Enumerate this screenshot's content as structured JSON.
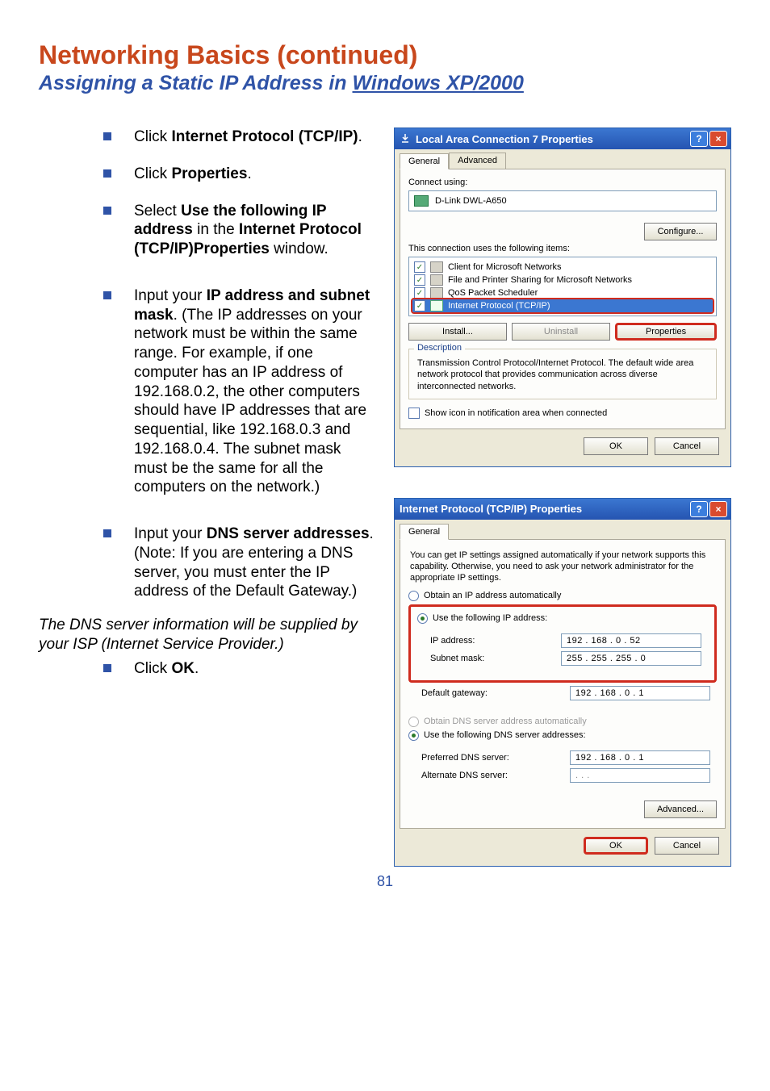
{
  "page": {
    "heading": "Networking Basics  (continued)",
    "subheading_prefix": "Assigning a Static IP Address in ",
    "subheading_underlined": "Windows XP/2000",
    "number": "81"
  },
  "bullets": {
    "b1_pre": "Click ",
    "b1_bold": "Internet Protocol (TCP/IP)",
    "b1_post": ".",
    "b2_pre": "Click ",
    "b2_bold": "Properties",
    "b2_post": ".",
    "b3_pre": "Select ",
    "b3_bold": "Use the following IP address",
    "b3_mid": " in the ",
    "b3_bold2": "Internet Protocol (TCP/IP)Properties",
    "b3_post": " window.",
    "b4_pre": "Input your ",
    "b4_bold": "IP address and subnet mask",
    "b4_post": ". (The IP addresses on your network must be within the same range. For example, if one computer has an IP address of 192.168.0.2, the other computers should have IP addresses that are sequential, like 192.168.0.3 and 192.168.0.4. The subnet mask must be the same for all the computers on the network.)",
    "b5_pre": "Input your ",
    "b5_bold": "DNS server addresses",
    "b5_post": ". (Note: If you are entering a DNS server, you must enter the IP address of the Default Gateway.)",
    "b6_pre": "Click ",
    "b6_bold": "OK",
    "b6_post": "."
  },
  "dns_note": "The DNS server information will be supplied by your ISP (Internet Service Provider.)",
  "dialog1": {
    "title": "Local Area Connection 7 Properties",
    "tab_general": "General",
    "tab_advanced": "Advanced",
    "connect_using": "Connect using:",
    "adapter": "D-Link DWL-A650",
    "configure_btn": "Configure...",
    "uses_items": "This connection uses the following items:",
    "item1": "Client for Microsoft Networks",
    "item2": "File and Printer Sharing for Microsoft Networks",
    "item3": "QoS Packet Scheduler",
    "item4": "Internet Protocol (TCP/IP)",
    "install": "Install...",
    "uninstall": "Uninstall",
    "properties": "Properties",
    "description_label": "Description",
    "description_text": "Transmission Control Protocol/Internet Protocol. The default wide area network protocol that provides communication across diverse interconnected networks.",
    "show_icon": "Show icon in notification area when connected",
    "ok": "OK",
    "cancel": "Cancel"
  },
  "dialog2": {
    "title": "Internet Protocol (TCP/IP) Properties",
    "tab_general": "General",
    "intro": "You can get IP settings assigned automatically if your network supports this capability. Otherwise, you need to ask your network administrator for the appropriate IP settings.",
    "radio_auto_ip": "Obtain an IP address automatically",
    "radio_use_ip": "Use the following IP address:",
    "ip_label": "IP address:",
    "ip_value": "192 . 168 .  0  . 52",
    "subnet_label": "Subnet mask:",
    "subnet_value": "255 . 255 . 255 .  0",
    "gateway_label": "Default gateway:",
    "gateway_value": "192 . 168 .  0  .  1",
    "radio_auto_dns": "Obtain DNS server address automatically",
    "radio_use_dns": "Use the following DNS server addresses:",
    "pref_dns_label": "Preferred DNS server:",
    "pref_dns_value": "192 . 168 .  0  .  1",
    "alt_dns_label": "Alternate DNS server:",
    "alt_dns_value": "   .      .      .   ",
    "advanced": "Advanced...",
    "ok": "OK",
    "cancel": "Cancel"
  }
}
